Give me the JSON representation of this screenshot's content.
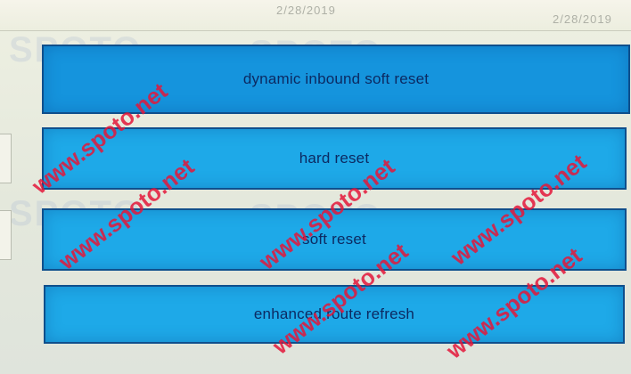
{
  "header": {
    "date_center": "2/28/2019",
    "date_right": "2/28/2019"
  },
  "options": [
    {
      "label": "dynamic inbound soft reset"
    },
    {
      "label": "hard reset"
    },
    {
      "label": "soft reset"
    },
    {
      "label": "enhanced route refresh"
    }
  ],
  "watermark": {
    "text": "www.spoto.net",
    "color": "#e4173a"
  },
  "background_logo": "SPOTO",
  "colors": {
    "option_fill": "#1ea9e8",
    "option_border": "#0f4f8c",
    "label_text": "#0c2a62"
  }
}
